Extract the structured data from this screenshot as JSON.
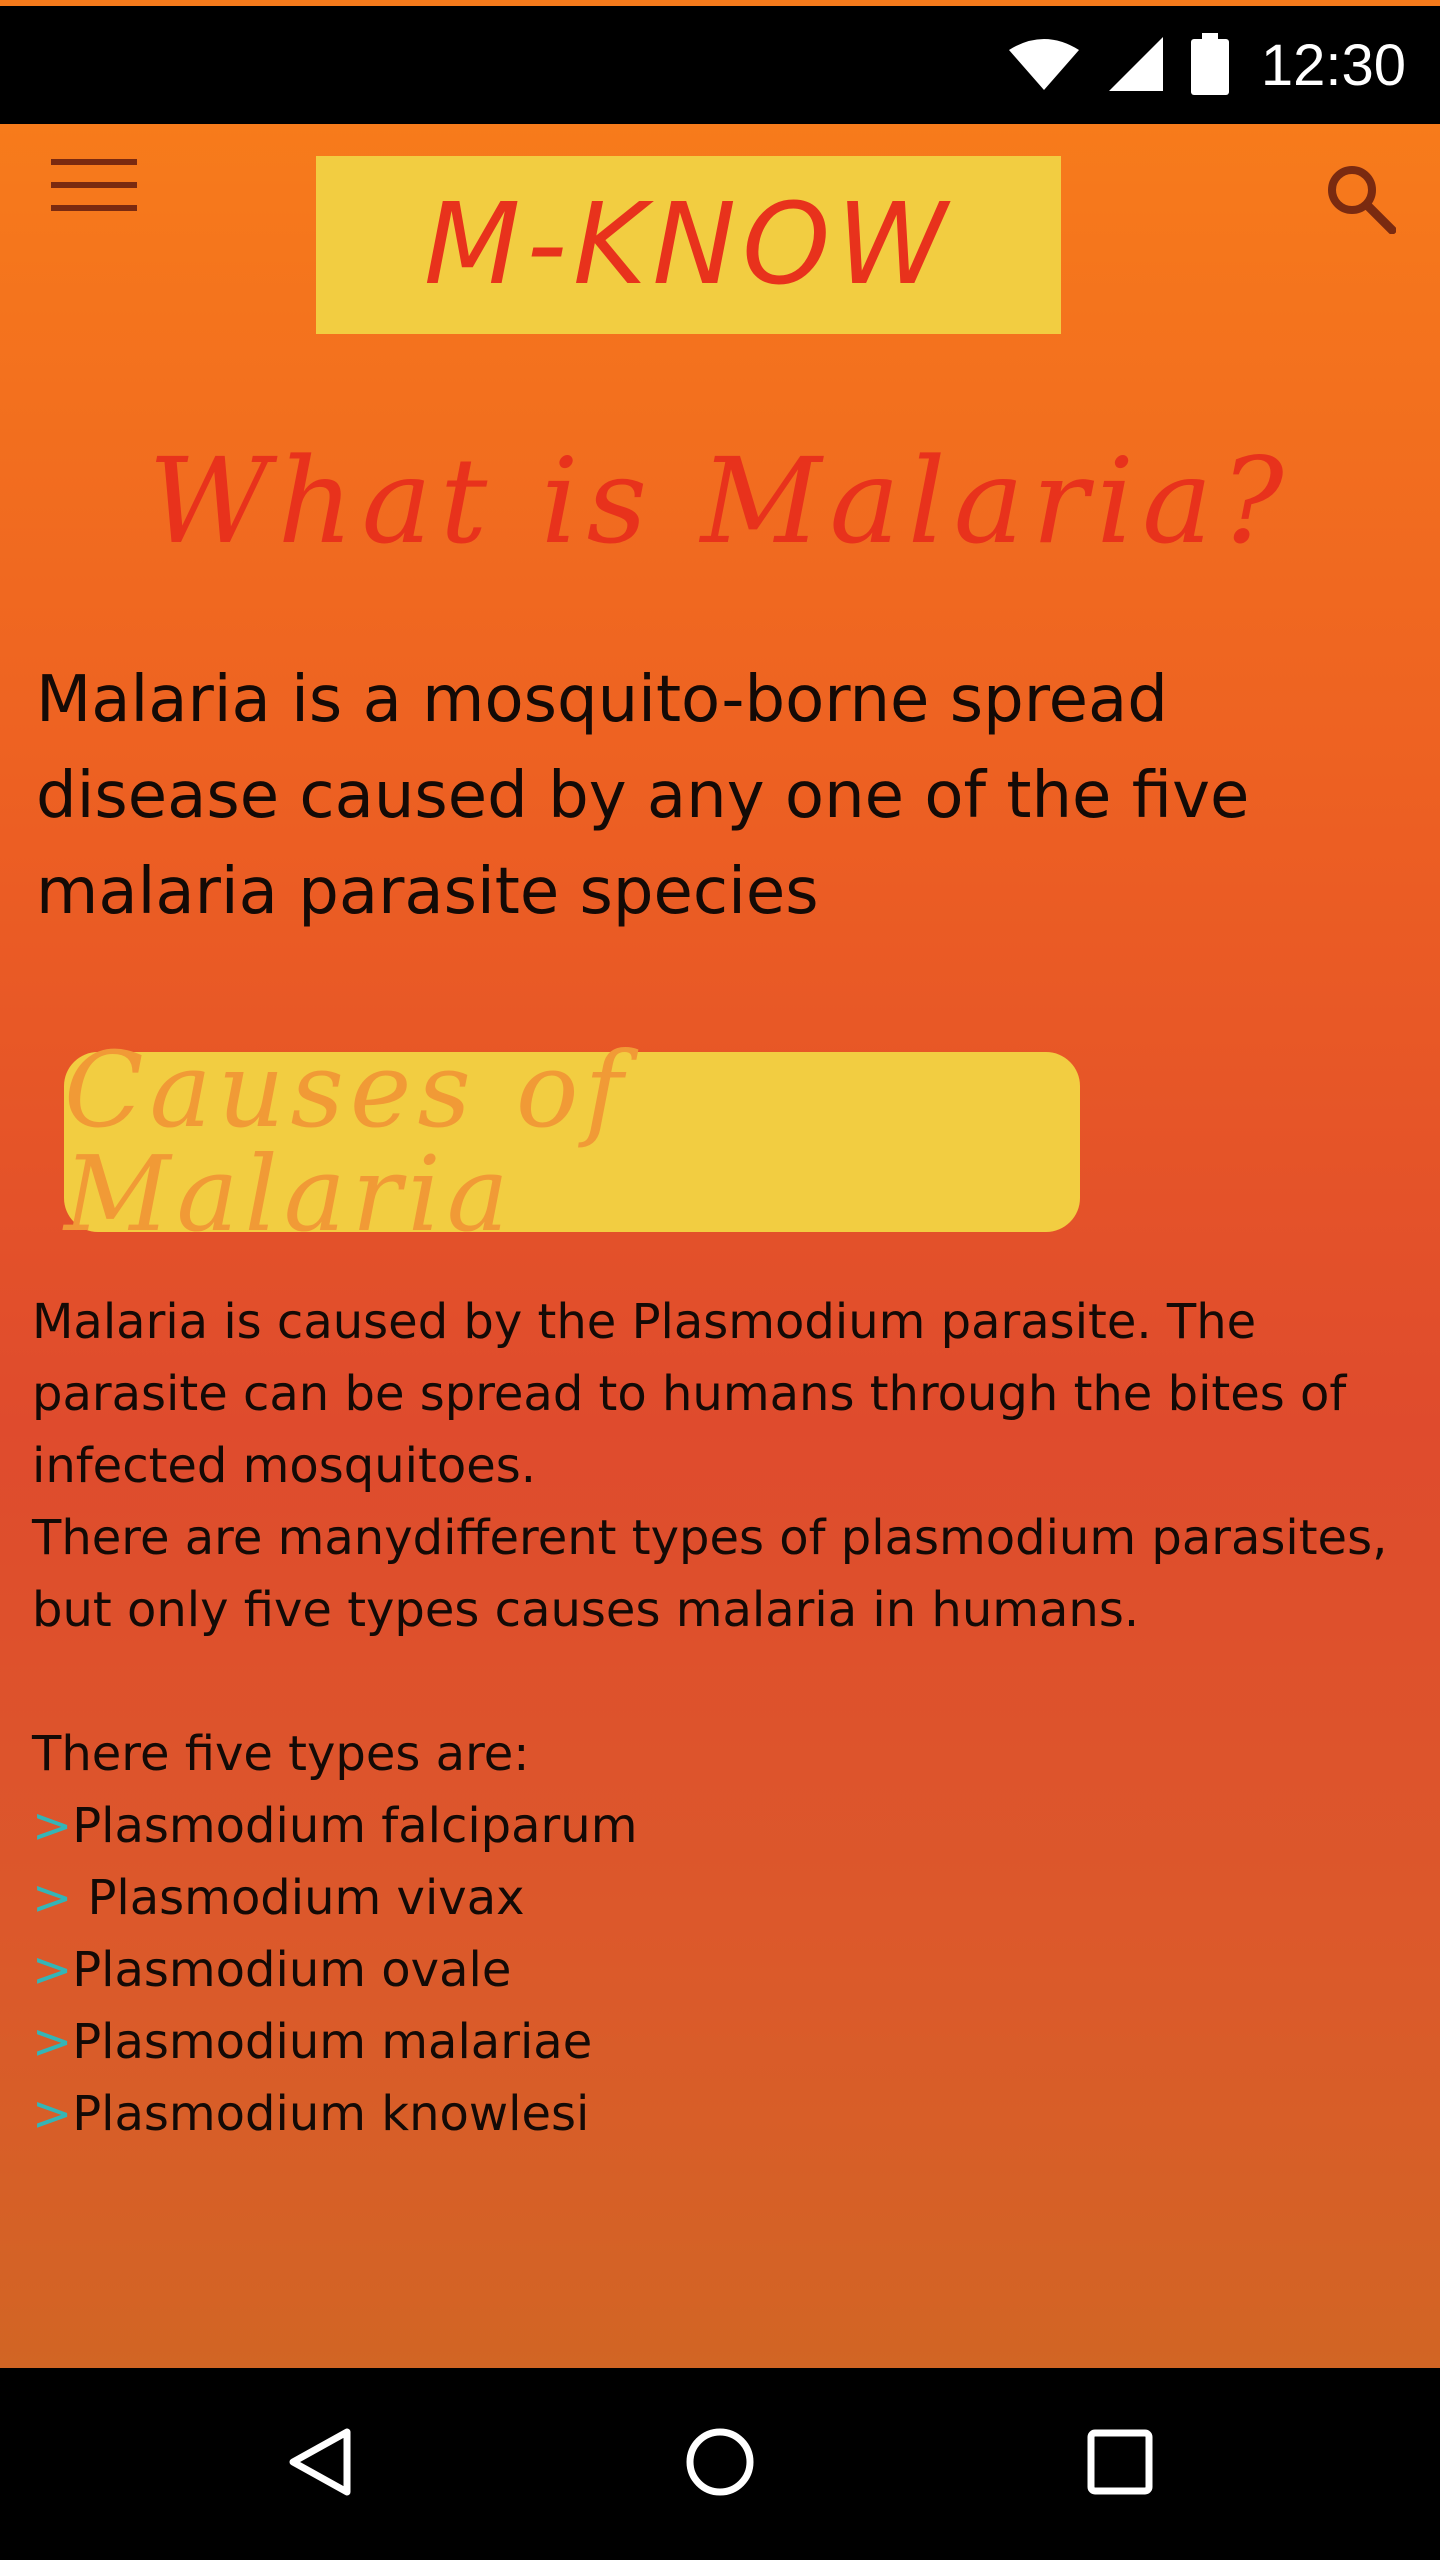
{
  "status_bar": {
    "time": "12:30",
    "icons": [
      "wifi-icon",
      "cell-signal-icon",
      "battery-icon"
    ]
  },
  "app_bar": {
    "menu_icon": "hamburger-menu-icon",
    "logo_text": "M-KNOW",
    "search_icon": "search-icon"
  },
  "main": {
    "title": "What is Malaria?",
    "intro": "Malaria is a mosquito-borne spread disease caused by any one of the five malaria parasite species",
    "section_heading": "Causes of Malaria",
    "paragraph_1": "Malaria is caused by the Plasmodium parasite. The parasite can be spread to humans through the bites of infected mosquitoes.",
    "paragraph_2": "There are manydifferent types of plasmodium parasites, but only five types causes malaria in humans.",
    "types_intro": "There five types are:",
    "types": [
      {
        "marker": ">",
        "label": "Plasmodium falciparum"
      },
      {
        "marker": ">",
        "label": " Plasmodium vivax"
      },
      {
        "marker": ">",
        "label": "Plasmodium ovale"
      },
      {
        "marker": ">",
        "label": "Plasmodium malariae"
      },
      {
        "marker": ">",
        "label": "Plasmodium knowlesi"
      }
    ]
  },
  "nav_bar": {
    "icons": [
      "back-icon",
      "home-icon",
      "recents-icon"
    ]
  },
  "colors": {
    "accent_red": "#e8321c",
    "logo_yellow": "#f2cd41",
    "heading_orange": "#f19a36",
    "arrow_teal": "#35b5b6"
  }
}
